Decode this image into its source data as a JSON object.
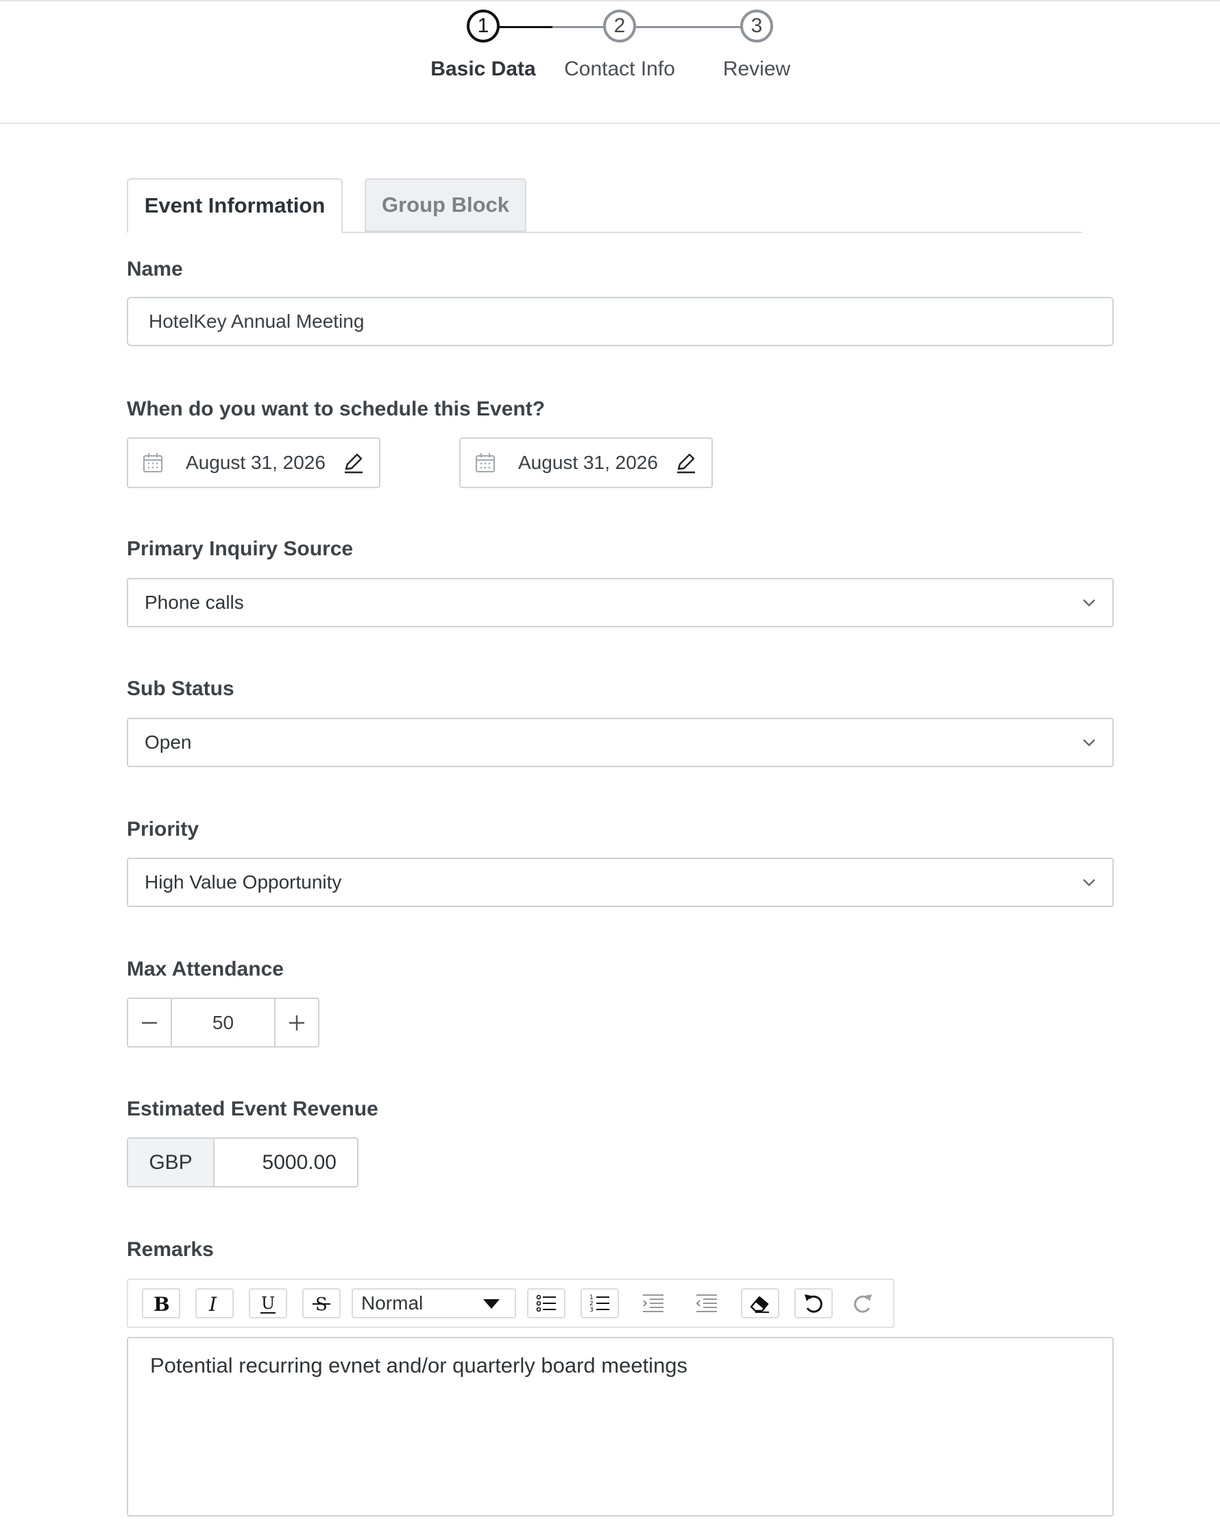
{
  "wizard": {
    "steps": [
      {
        "number": "1",
        "label": "Basic Data",
        "state": "active"
      },
      {
        "number": "2",
        "label": "Contact Info",
        "state": "inactive"
      },
      {
        "number": "3",
        "label": "Review",
        "state": "inactive"
      }
    ]
  },
  "tabs": [
    {
      "label": "Event Information",
      "active": true
    },
    {
      "label": "Group Block",
      "active": false
    }
  ],
  "form": {
    "name": {
      "label": "Name",
      "value": "HotelKey Annual Meeting"
    },
    "schedule": {
      "label": "When do you want to schedule this Event?",
      "start_date": "August 31, 2026",
      "end_date": "August 31, 2026"
    },
    "inquiry_source": {
      "label": "Primary Inquiry Source",
      "value": "Phone calls"
    },
    "sub_status": {
      "label": "Sub Status",
      "value": "Open"
    },
    "priority": {
      "label": "Priority",
      "value": "High Value Opportunity"
    },
    "max_attendance": {
      "label": "Max Attendance",
      "value": "50"
    },
    "revenue": {
      "label": "Estimated Event Revenue",
      "currency": "GBP",
      "amount": "5000.00"
    },
    "remarks": {
      "label": "Remarks",
      "text_format": "Normal",
      "text": "Potential recurring evnet and/or quarterly board meetings"
    }
  },
  "colors": {
    "active_step": "#111111",
    "inactive_step": "#8e949a",
    "border": "#cfd3d7",
    "inactive_tab_bg": "#eef0f2"
  },
  "icons": {
    "date_field": "calendar-icon",
    "date_edit": "pencil-icon",
    "select": "chevron-down-icon",
    "decrement": "minus-icon",
    "increment": "plus-icon"
  }
}
